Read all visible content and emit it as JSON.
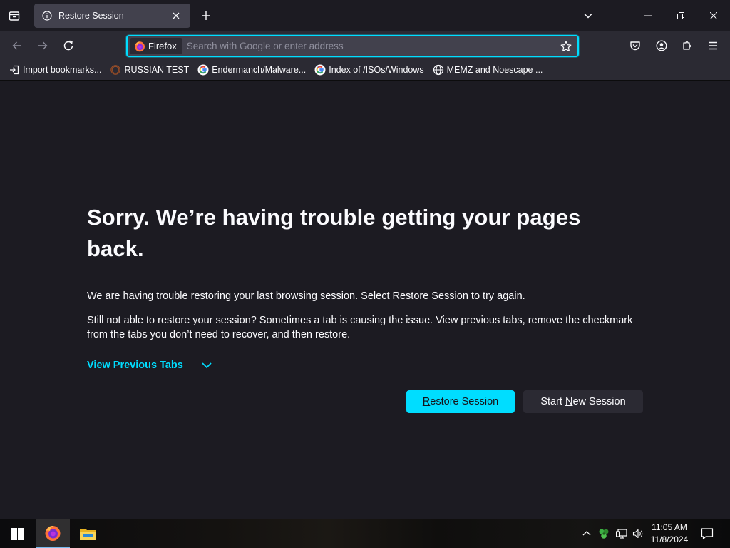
{
  "browser": {
    "tab": {
      "title": "Restore Session",
      "icon": "info-icon"
    },
    "identity_label": "Firefox",
    "url": {
      "value": "",
      "placeholder": "Search with Google or enter address"
    },
    "bookmarks": [
      {
        "label": "Import bookmarks...",
        "icon": "import-icon"
      },
      {
        "label": "RUSSIAN TEST",
        "icon": "ring-favicon"
      },
      {
        "label": "Endermanch/Malware...",
        "icon": "google-favicon"
      },
      {
        "label": "Index of /ISOs/Windows",
        "icon": "google-favicon"
      },
      {
        "label": "MEMZ and Noescape ...",
        "icon": "globe-icon"
      }
    ]
  },
  "page": {
    "title": "Sorry. We’re having trouble getting your pages back.",
    "paragraph1": "We are having trouble restoring your last browsing session. Select Restore Session to try again.",
    "paragraph2": "Still not able to restore your session? Sometimes a tab is causing the issue. View previous tabs, remove the checkmark from the tabs you don’t need to recover, and then restore.",
    "view_previous_tabs": "View Previous Tabs",
    "restore_button": {
      "underlined": "R",
      "rest": "estore Session"
    },
    "new_session_button": {
      "before": "Start ",
      "underlined": "N",
      "after": "ew Session"
    }
  },
  "taskbar": {
    "time": "11:05 AM",
    "date": "11/8/2024",
    "apps": [
      "firefox",
      "file-explorer"
    ]
  },
  "colors": {
    "accent": "#00ddff",
    "background": "#1c1b22",
    "toolbar": "#2b2a33",
    "field": "#42414d"
  }
}
